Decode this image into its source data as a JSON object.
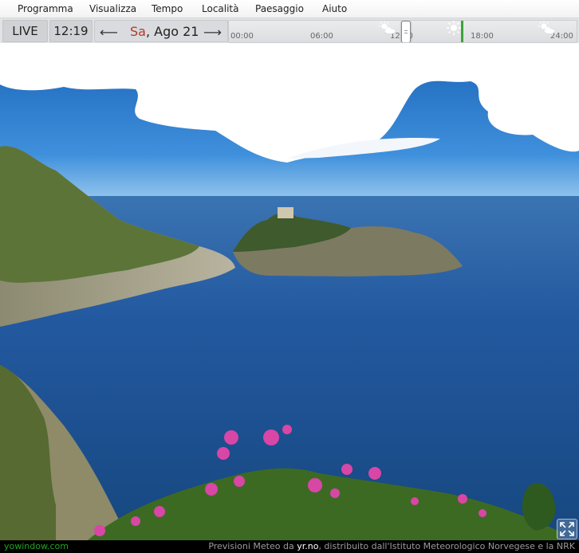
{
  "menu": [
    "Programma",
    "Visualizza",
    "Tempo",
    "Località",
    "Paesaggio",
    "Aiuto"
  ],
  "toolbar": {
    "live_label": "LIVE",
    "time": "12:19",
    "date_day": "Sa",
    "date_rest": ", Ago 21"
  },
  "timeline": {
    "ticks": [
      "00:00",
      "06:00",
      "12:00",
      "18:00",
      "24:00"
    ],
    "current_time_fraction": 0.51,
    "now_fraction": 0.67,
    "weather_icons": [
      "partly-cloudy-icon",
      "sun-icon",
      "partly-cloudy-icon"
    ]
  },
  "status": {
    "website": "yowindow.com",
    "forecast_prefix": "Previsioni Meteo da ",
    "forecast_source": "yr.no",
    "forecast_suffix": ", distribuito dall'Istituto Meteorologico Norvegese e la NRK"
  },
  "colors": {
    "accent_green": "#3aa53a",
    "date_day_red": "#b4382c",
    "sky_top": "#1f6fc4",
    "sea": "#1d4f86"
  }
}
